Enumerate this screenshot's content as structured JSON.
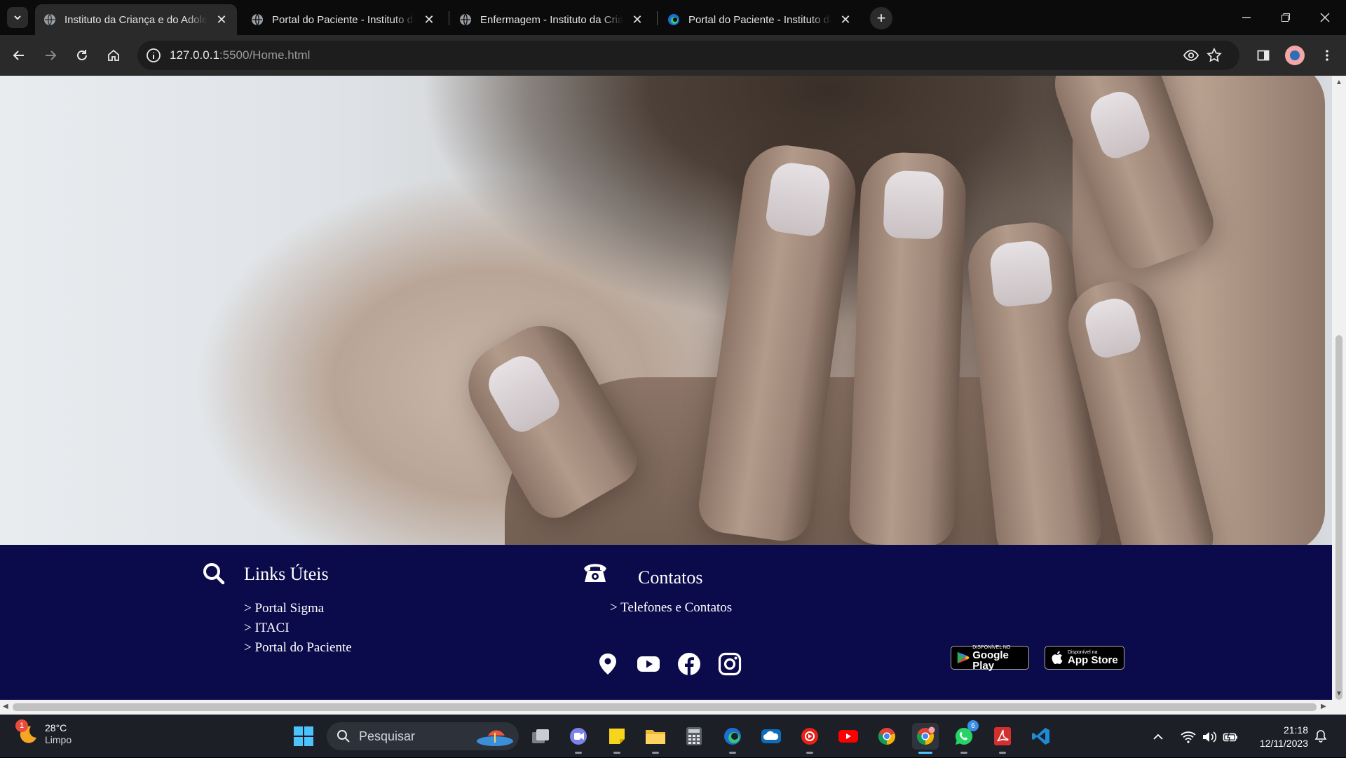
{
  "browser": {
    "tabs": [
      {
        "title": "Instituto da Criança e do Adolescente",
        "active": true,
        "favicon": "globe-icon"
      },
      {
        "title": "Portal do Paciente - Instituto da Criança",
        "active": false,
        "favicon": "globe-icon"
      },
      {
        "title": "Enfermagem - Instituto da Criança",
        "active": false,
        "favicon": "globe-icon"
      },
      {
        "title": "Portal do Paciente - Instituto da Criança",
        "active": false,
        "favicon": "edge-icon"
      }
    ],
    "url_host": "127.0.0.1",
    "url_path": ":5500/Home.html"
  },
  "page": {
    "hero_alt": "newborn-head-in-hands-photo",
    "footer": {
      "background": "#0b0a4b",
      "links_heading": "Links Úteis",
      "links": [
        "> Portal Sigma",
        "> ITACI",
        "> Portal do Paciente"
      ],
      "contacts_heading": "Contatos",
      "contacts_links": [
        "> Telefones e Contatos"
      ],
      "social": [
        "location-pin-icon",
        "youtube-icon",
        "facebook-icon",
        "instagram-icon"
      ],
      "store_badges": [
        {
          "small": "DISPONÍVEL NO",
          "big": "Google Play"
        },
        {
          "small": "Disponível na",
          "big": "App Store"
        }
      ]
    }
  },
  "taskbar": {
    "weather_temp": "28°C",
    "weather_desc": "Limpo",
    "weather_badge": "1",
    "search_placeholder": "Pesquisar",
    "whatsapp_badge": "6",
    "time": "21:18",
    "date": "12/11/2023"
  }
}
